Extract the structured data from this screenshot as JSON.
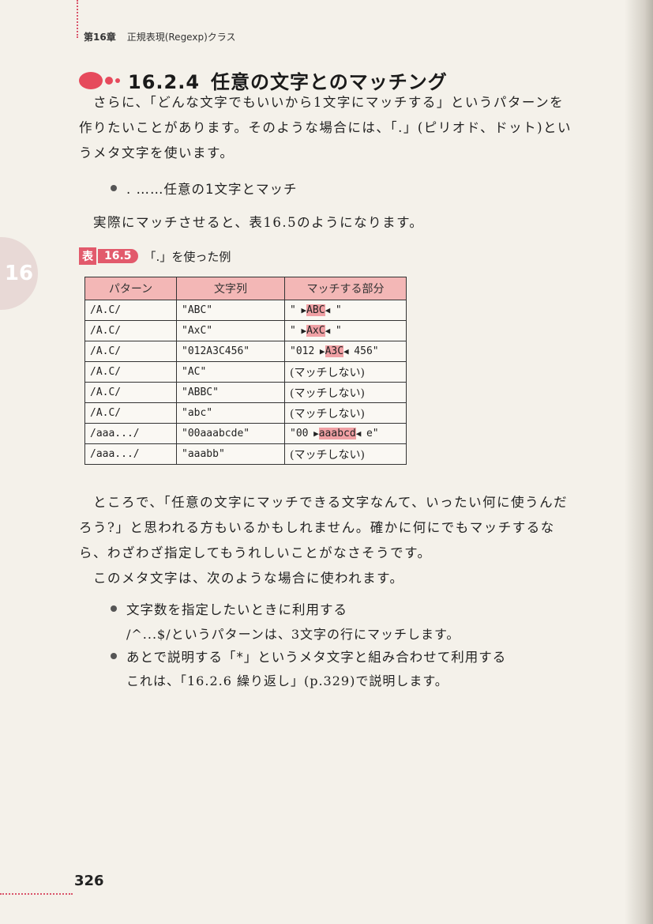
{
  "running_head": {
    "chapter": "第16章",
    "title": "正規表現(Regexp)クラス"
  },
  "chapter_tab": "16",
  "section": {
    "number": "16.2.4",
    "title": "任意の文字とのマッチング"
  },
  "intro": {
    "line1": "さらに、「どんな文字でもいいから1文字にマッチする」というパターンを",
    "line2": "作りたいことがあります。そのような場合には、「.」(ピリオド、ドット)とい",
    "line3": "うメタ文字を使います。"
  },
  "bullet_dot": ". ……任意の1文字とマッチ",
  "table_intro": "実際にマッチさせると、表16.5のようになります。",
  "table": {
    "label": "表",
    "number": "16.5",
    "caption": "「.」を使った例",
    "headers": [
      "パターン",
      "文字列",
      "マッチする部分"
    ],
    "rows": [
      {
        "pattern": "/A.C/",
        "string": "\"ABC\"",
        "pre": "\"",
        "match": "ABC",
        "post": "\""
      },
      {
        "pattern": "/A.C/",
        "string": "\"AxC\"",
        "pre": "\"",
        "match": "AxC",
        "post": "\""
      },
      {
        "pattern": "/A.C/",
        "string": "\"012A3C456\"",
        "pre": "\"012",
        "match": "A3C",
        "post": "456\""
      },
      {
        "pattern": "/A.C/",
        "string": "\"AC\"",
        "nomatch": "(マッチしない)"
      },
      {
        "pattern": "/A.C/",
        "string": "\"ABBC\"",
        "nomatch": "(マッチしない)"
      },
      {
        "pattern": "/A.C/",
        "string": "\"abc\"",
        "nomatch": "(マッチしない)"
      },
      {
        "pattern": "/aaa.../",
        "string": "\"00aaabcde\"",
        "pre": "\"00",
        "match": "aaabcd",
        "post": "e\""
      },
      {
        "pattern": "/aaa.../",
        "string": "\"aaabb\"",
        "nomatch": "(マッチしない)"
      }
    ]
  },
  "body2": {
    "line1": "ところで、「任意の文字にマッチできる文字なんて、いったい何に使うんだ",
    "line2": "ろう?」と思われる方もいるかもしれません。確かに何にでもマッチするな",
    "line3": "ら、わざわざ指定してもうれしいことがなさそうです。",
    "line4": "このメタ文字は、次のような場合に使われます。"
  },
  "uses": [
    {
      "title": "文字数を指定したいときに利用する",
      "detail": "/^...$/というパターンは、3文字の行にマッチします。"
    },
    {
      "title": "あとで説明する「*」というメタ文字と組み合わせて利用する",
      "detail": "これは、「16.2.6 繰り返し」(p.329)で説明します。"
    }
  ],
  "page_number": "326"
}
